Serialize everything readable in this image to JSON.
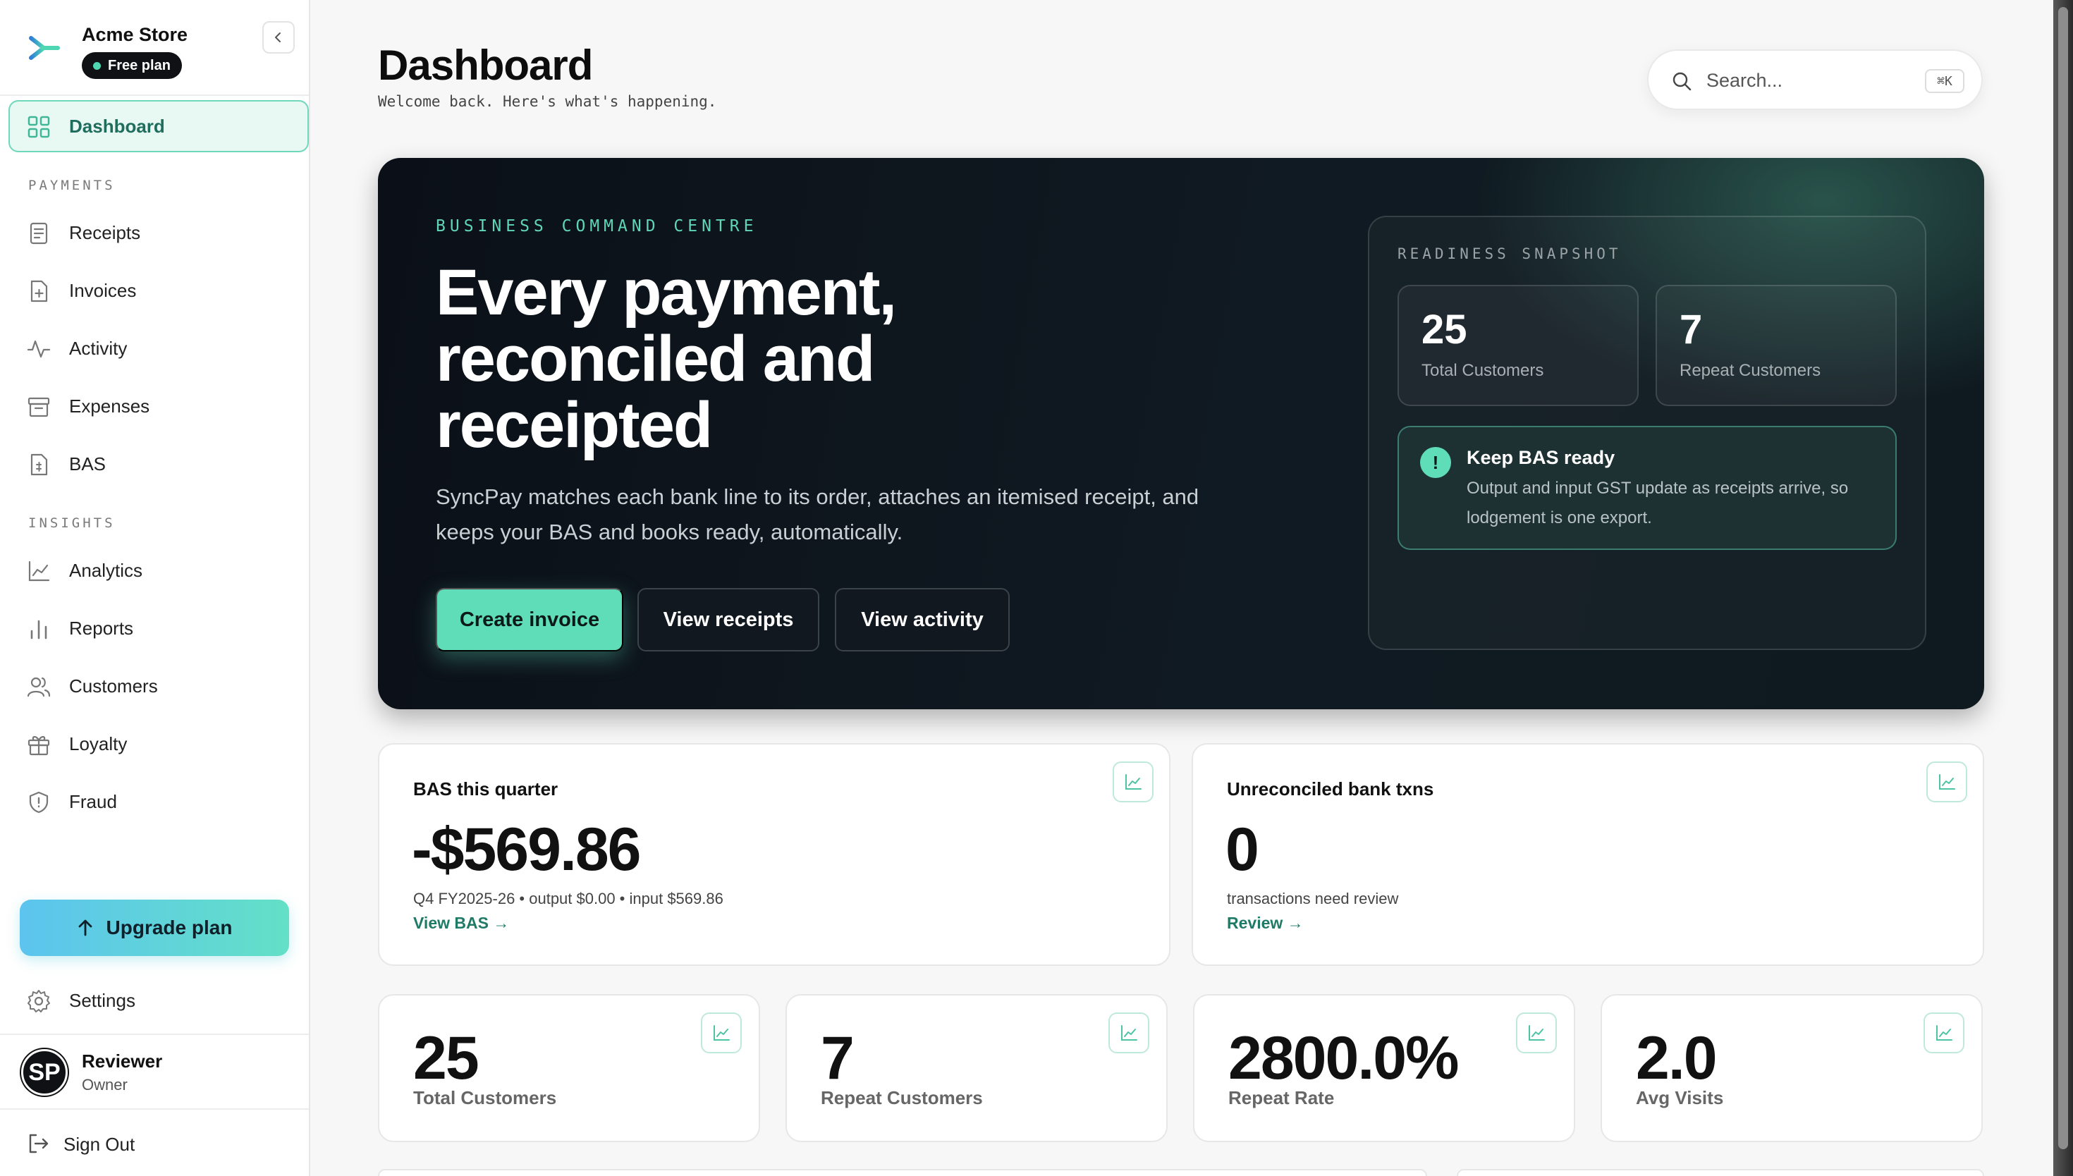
{
  "brand": {
    "name": "Acme Store",
    "plan": "Free plan"
  },
  "sidebar": {
    "dashboard": "Dashboard",
    "sections": {
      "payments": "PAYMENTS",
      "insights": "INSIGHTS"
    },
    "payments": [
      {
        "label": "Receipts",
        "icon": "receipt-icon"
      },
      {
        "label": "Invoices",
        "icon": "invoice-icon"
      },
      {
        "label": "Activity",
        "icon": "activity-icon"
      },
      {
        "label": "Expenses",
        "icon": "expenses-icon"
      },
      {
        "label": "BAS",
        "icon": "bas-icon"
      }
    ],
    "insights": [
      {
        "label": "Analytics",
        "icon": "analytics-icon"
      },
      {
        "label": "Reports",
        "icon": "reports-icon"
      },
      {
        "label": "Customers",
        "icon": "customers-icon"
      },
      {
        "label": "Loyalty",
        "icon": "gift-icon"
      },
      {
        "label": "Fraud",
        "icon": "shield-icon"
      }
    ],
    "upgrade": "Upgrade plan",
    "settings": "Settings",
    "user": {
      "initials": "SP",
      "name": "Reviewer",
      "role": "Owner"
    },
    "sign_out": "Sign Out"
  },
  "header": {
    "title": "Dashboard",
    "subtitle": "Welcome back. Here's what's happening.",
    "search_placeholder": "Search...",
    "search_shortcut": "⌘K"
  },
  "hero": {
    "eyebrow": "BUSINESS COMMAND CENTRE",
    "title": "Every payment, reconciled and receipted",
    "description": "SyncPay matches each bank line to its order, attaches an itemised receipt, and keeps your BAS and books ready, automatically.",
    "buttons": {
      "create": "Create invoice",
      "receipts": "View receipts",
      "activity": "View activity"
    },
    "snapshot": {
      "title": "READINESS SNAPSHOT",
      "stats": [
        {
          "value": "25",
          "label": "Total Customers"
        },
        {
          "value": "7",
          "label": "Repeat Customers"
        }
      ],
      "alert": {
        "icon": "!",
        "title": "Keep BAS ready",
        "text": "Output and input GST update as receipts arrive, so lodgement is one export."
      }
    }
  },
  "cards": {
    "bas": {
      "title": "BAS this quarter",
      "value": "-$569.86",
      "meta": "Q4 FY2025-26 • output $0.00 • input $569.86",
      "link": "View BAS →"
    },
    "unreconciled": {
      "title": "Unreconciled bank txns",
      "value": "0",
      "meta": "transactions need review",
      "link": "Review →"
    },
    "stats": [
      {
        "value": "25",
        "label": "Total Customers"
      },
      {
        "value": "7",
        "label": "Repeat Customers"
      },
      {
        "value": "2800.0%",
        "label": "Repeat Rate"
      },
      {
        "value": "2.0",
        "label": "Avg Visits"
      }
    ]
  },
  "colors": {
    "accent": "#5fdcb8",
    "accent_dark": "#1f7a66",
    "hero_bg": "#0b1018"
  }
}
